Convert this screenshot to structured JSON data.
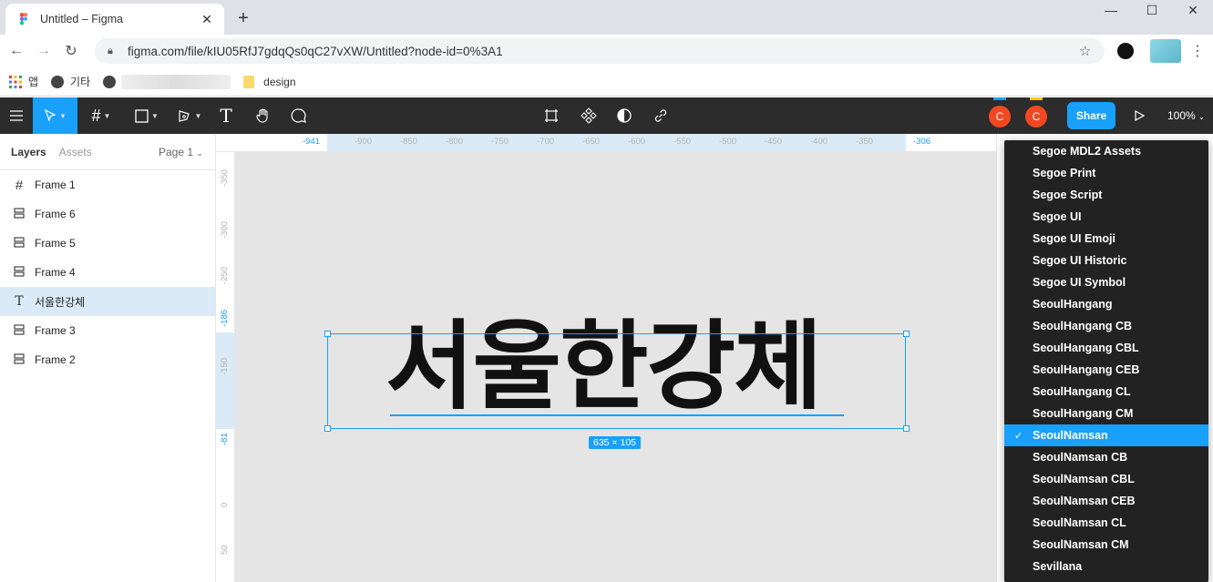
{
  "browser": {
    "tab_title": "Untitled – Figma",
    "url": "figma.com/file/kIU05RfJ7gdqQs0qC27vXW/Untitled?node-id=0%3A1",
    "bookmarks": [
      {
        "label": "앱",
        "icon": "apps-grid-icon"
      },
      {
        "label": "기타",
        "icon": "globe-icon"
      },
      {
        "label": "design",
        "icon": "folder-icon"
      }
    ]
  },
  "toolbar": {
    "share_label": "Share",
    "zoom": "100%",
    "avatars": [
      "C",
      "C"
    ],
    "accent": "#18a0fb"
  },
  "left_panel": {
    "tabs": [
      "Layers",
      "Assets"
    ],
    "page": "Page 1",
    "layers": [
      {
        "name": "Frame 1",
        "icon": "frame-icon"
      },
      {
        "name": "Frame 6",
        "icon": "auto-layout-icon"
      },
      {
        "name": "Frame 5",
        "icon": "auto-layout-icon"
      },
      {
        "name": "Frame 4",
        "icon": "auto-layout-icon"
      },
      {
        "name": "서울한강체",
        "icon": "text-icon",
        "selected": true
      },
      {
        "name": "Frame 3",
        "icon": "auto-layout-icon"
      },
      {
        "name": "Frame 2",
        "icon": "auto-layout-icon"
      }
    ]
  },
  "rulers": {
    "top": [
      "-941",
      "-900",
      "-850",
      "-800",
      "-750",
      "-700",
      "-650",
      "-600",
      "-550",
      "-500",
      "-450",
      "-400",
      "-350",
      "-306"
    ],
    "left": [
      "-350",
      "-300",
      "-250",
      "-186",
      "-150",
      "-81",
      "0",
      "50"
    ]
  },
  "canvas": {
    "text": "서울한강체",
    "dimensions": "635 × 105"
  },
  "font_menu": {
    "items": [
      "Segoe MDL2 Assets",
      "Segoe Print",
      "Segoe Script",
      "Segoe UI",
      "Segoe UI Emoji",
      "Segoe UI Historic",
      "Segoe UI Symbol",
      "SeoulHangang",
      "SeoulHangang CB",
      "SeoulHangang CBL",
      "SeoulHangang CEB",
      "SeoulHangang CL",
      "SeoulHangang CM",
      "SeoulNamsan",
      "SeoulNamsan CB",
      "SeoulNamsan CBL",
      "SeoulNamsan CEB",
      "SeoulNamsan CL",
      "SeoulNamsan CM",
      "Sevillana"
    ],
    "selected": "SeoulNamsan"
  }
}
